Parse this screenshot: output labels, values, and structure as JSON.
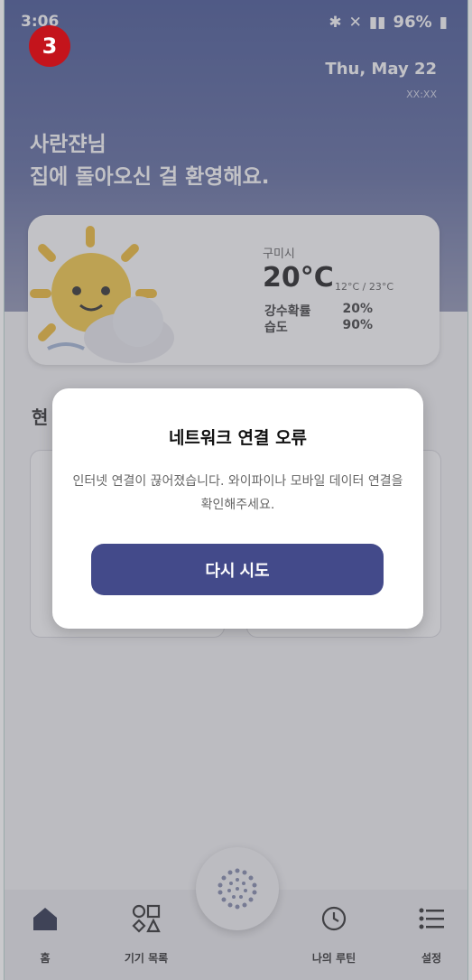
{
  "status": {
    "time": "3:06",
    "battery": "96%"
  },
  "badge": "3",
  "header": {
    "date": "Thu, May 22",
    "time_sub": "XX:XX",
    "greeting_line1": "사란쟌님",
    "greeting_line2": "집에 돌아오신 걸 환영해요."
  },
  "weather": {
    "city": "구미시",
    "temp": "20°C",
    "range": "12°C / 23°C",
    "rain_label": "강수확률",
    "rain_value": "20%",
    "humidity_label": "습도",
    "humidity_value": "90%"
  },
  "section": {
    "title_partial": "현"
  },
  "dialog": {
    "title": "네트워크 연결 오류",
    "message": "인터넷 연결이 끊어졌습니다. 와이파이나 모바일 데이터 연결을 확인해주세요.",
    "button": "다시 시도"
  },
  "tabs": [
    {
      "label": "홈",
      "icon": "home-icon"
    },
    {
      "label": "기기 목록",
      "icon": "devices-icon"
    },
    {
      "label": "나의 루틴",
      "icon": "routine-icon"
    },
    {
      "label": "설정",
      "icon": "settings-icon"
    }
  ],
  "colors": {
    "header": "#3b4d91",
    "accent": "#434a8a",
    "badge": "#c4141c"
  }
}
